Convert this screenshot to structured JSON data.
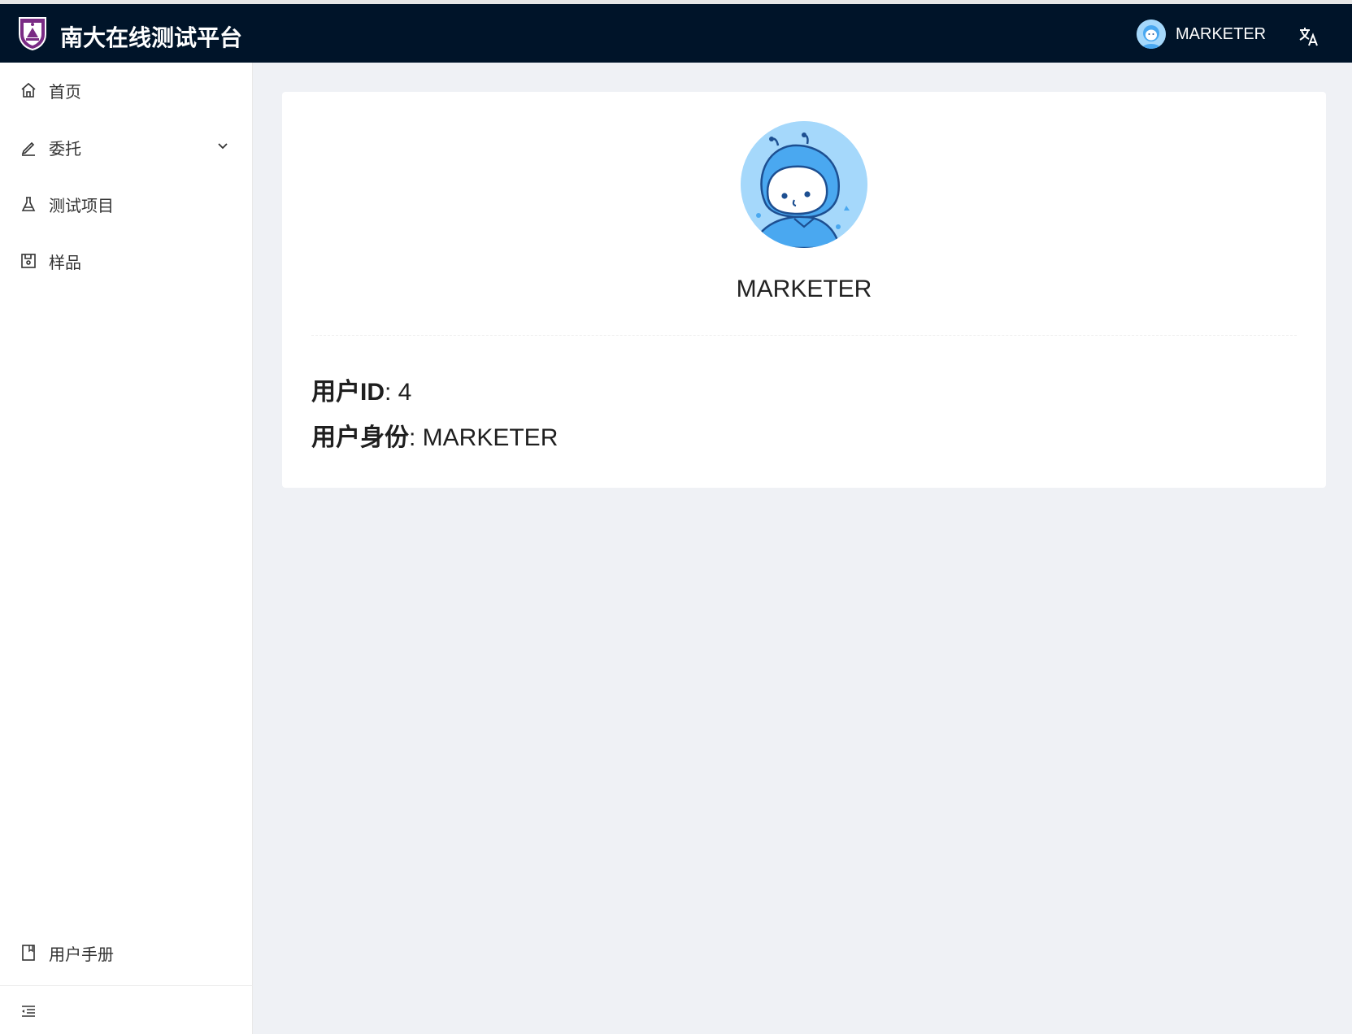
{
  "header": {
    "app_title": "南大在线测试平台",
    "username": "MARKETER",
    "background": "#001429"
  },
  "sidebar": {
    "items": [
      {
        "label": "首页",
        "icon": "home-icon"
      },
      {
        "label": "委托",
        "icon": "edit-icon",
        "expandable": true
      },
      {
        "label": "测试项目",
        "icon": "flask-icon"
      },
      {
        "label": "样品",
        "icon": "save-icon"
      }
    ],
    "bottom_item": {
      "label": "用户手册",
      "icon": "book-icon"
    },
    "collapse_icon": "menu-fold-icon"
  },
  "profile": {
    "name": "MARKETER",
    "user_id_label": "用户ID",
    "user_id_value": ": 4",
    "role_label": "用户身份",
    "role_value": ": MARKETER",
    "avatar_color": "#a5d8fb"
  }
}
